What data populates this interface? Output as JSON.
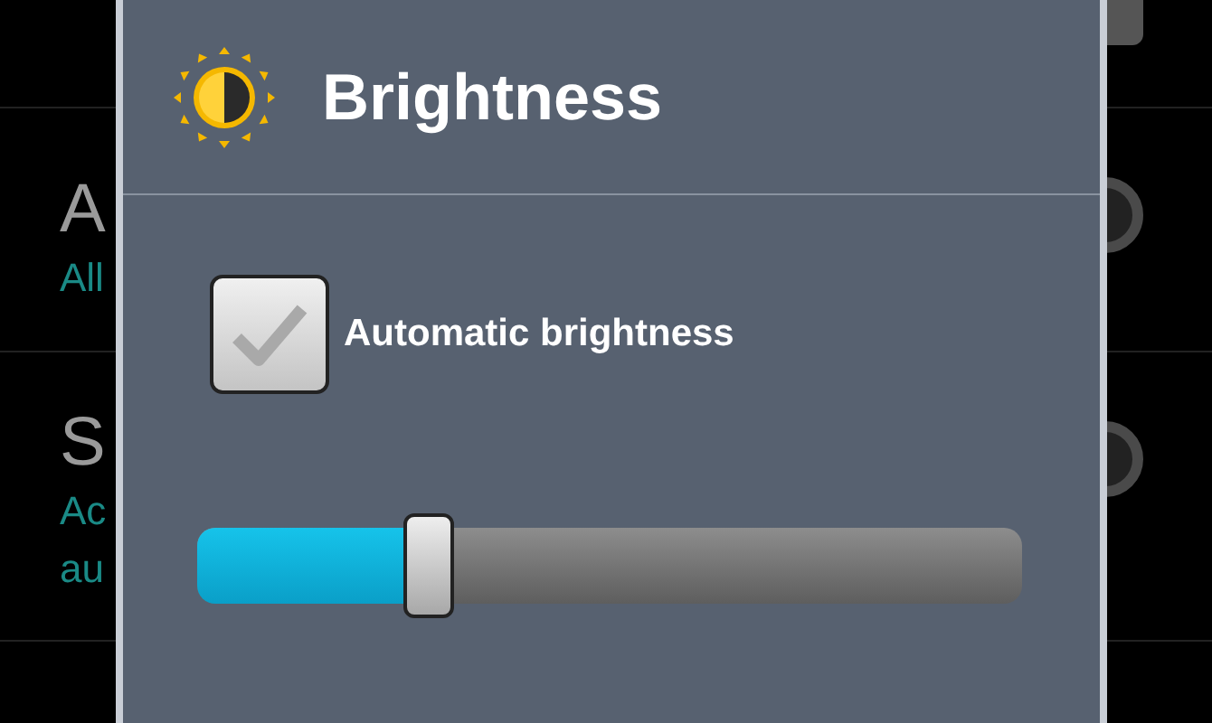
{
  "background_list": [
    {
      "kind": "square"
    },
    {
      "kind": "radio",
      "title": "A",
      "summary": [
        "All"
      ]
    },
    {
      "kind": "radio",
      "title": "S",
      "summary": [
        "Ac",
        "au"
      ]
    }
  ],
  "dialog": {
    "title": "Brightness",
    "auto_checkbox": {
      "label": "Automatic brightness",
      "checked": true
    },
    "slider": {
      "level": 0.28
    }
  }
}
